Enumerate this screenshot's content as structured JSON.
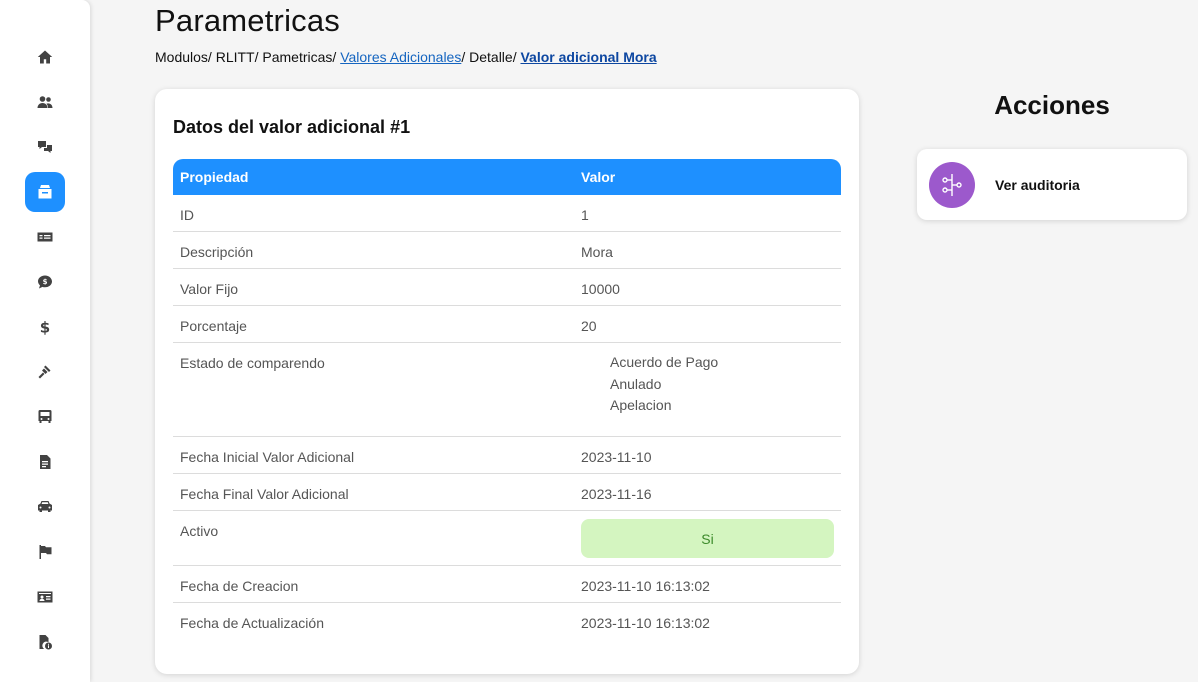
{
  "sidebar": {
    "items": [
      {
        "icon": "home-icon"
      },
      {
        "icon": "users-icon"
      },
      {
        "icon": "translate-icon"
      },
      {
        "icon": "parametrics-icon",
        "active": true
      },
      {
        "icon": "money-card-icon"
      },
      {
        "icon": "dollar-chat-icon"
      },
      {
        "icon": "dollar-icon"
      },
      {
        "icon": "gavel-icon"
      },
      {
        "icon": "bus-icon"
      },
      {
        "icon": "document-icon"
      },
      {
        "icon": "car-icon"
      },
      {
        "icon": "flag-icon"
      },
      {
        "icon": "id-card-icon"
      },
      {
        "icon": "file-info-icon"
      }
    ]
  },
  "header": {
    "title": "Parametricas",
    "breadcrumb": {
      "b1": "Modulos/ ",
      "b2": "RLITT/ ",
      "b3": "Pametricas/ ",
      "link1": "Valores Adicionales",
      "b4": "/ Detalle/ ",
      "current": "Valor adicional Mora"
    }
  },
  "card": {
    "title": "Datos del valor adicional #1",
    "columns": {
      "property": "Propiedad",
      "value": "Valor"
    },
    "rows": {
      "id": {
        "label": "ID",
        "value": "1"
      },
      "descripcion": {
        "label": "Descripción",
        "value": "Mora"
      },
      "valor_fijo": {
        "label": "Valor Fijo",
        "value": "10000"
      },
      "porcentaje": {
        "label": "Porcentaje",
        "value": "20"
      },
      "estado": {
        "label": "Estado de comparendo",
        "values": [
          "Acuerdo de Pago",
          "Anulado",
          "Apelacion"
        ]
      },
      "fecha_inicial": {
        "label": "Fecha Inicial Valor Adicional",
        "value": "2023-11-10"
      },
      "fecha_final": {
        "label": "Fecha Final Valor Adicional",
        "value": "2023-11-16"
      },
      "activo": {
        "label": "Activo",
        "value": "Si"
      },
      "fecha_creacion": {
        "label": "Fecha de Creacion",
        "value": "2023-11-10 16:13:02"
      },
      "fecha_actualizacion": {
        "label": "Fecha de Actualización",
        "value": "2023-11-10 16:13:02"
      }
    }
  },
  "actions": {
    "title": "Acciones",
    "items": [
      {
        "label": "Ver auditoria",
        "icon": "audit-icon"
      }
    ]
  },
  "colors": {
    "accent": "#1e90ff",
    "active_badge_bg": "#d4f5c0",
    "action_icon_bg": "#9c59cc"
  }
}
